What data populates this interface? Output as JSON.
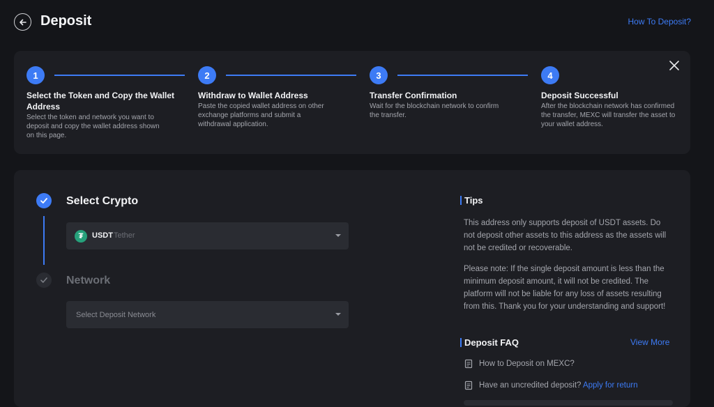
{
  "header": {
    "title": "Deposit",
    "how_to_link": "How To Deposit?"
  },
  "steps": [
    {
      "num": "1",
      "title": "Select the Token and Copy the Wallet Address",
      "desc": "Select the token and network you want to deposit and copy the wallet address shown on this page."
    },
    {
      "num": "2",
      "title": "Withdraw to Wallet Address",
      "desc": "Paste the copied wallet address on other exchange platforms and submit a withdrawal application."
    },
    {
      "num": "3",
      "title": "Transfer Confirmation",
      "desc": "Wait for the blockchain network to confirm the transfer."
    },
    {
      "num": "4",
      "title": "Deposit Successful",
      "desc": "After the blockchain network has confirmed the transfer, MEXC will transfer the asset to your wallet address."
    }
  ],
  "form": {
    "select_crypto_title": "Select Crypto",
    "crypto": {
      "symbol": "USDT",
      "name": "Tether",
      "icon": "tether-icon",
      "color": "#26a17b"
    },
    "network_title": "Network",
    "network_placeholder": "Select Deposit Network"
  },
  "tips": {
    "title": "Tips",
    "p1": "This address only supports deposit of USDT assets. Do not deposit other assets to this address as the assets will not be credited or recoverable.",
    "p2": "Please note: If the single deposit amount is less than the minimum deposit amount, it will not be credited. The platform will not be liable for any loss of assets resulting from this. Thank you for your understanding and support!"
  },
  "faq": {
    "title": "Deposit FAQ",
    "view_more": "View More",
    "items": [
      {
        "text": "How to Deposit on MEXC?",
        "link": ""
      },
      {
        "text": "Have an uncredited deposit?",
        "link": "Apply for return"
      }
    ]
  },
  "colors": {
    "accent": "#3d7bf5",
    "background": "#141519",
    "card": "#1d1e23",
    "input": "#2a2c32"
  }
}
